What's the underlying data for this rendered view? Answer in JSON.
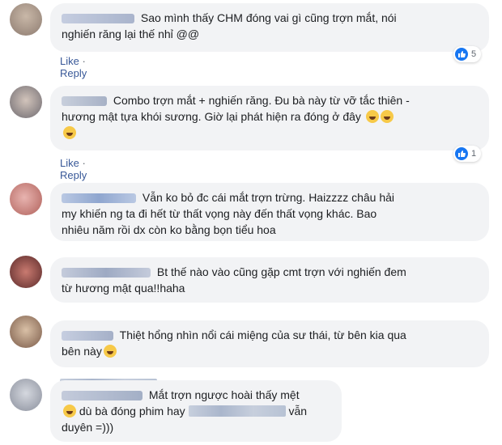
{
  "colors": {
    "link": "#385898",
    "bubble": "#f2f3f5",
    "like_blue": "#1877f2"
  },
  "comments": [
    {
      "text_line1": "Sao mình thấy CHM đóng vai gì cũng trợn mắt, nói",
      "text_line2": "nghiến răng lại thế nhỉ @@",
      "like": "Like",
      "reply": "Reply",
      "dot": "·",
      "reactions": "5"
    },
    {
      "text_line1": "Combo trợn mắt + nghiến răng. Đu bà này từ vỡ tắc thiên -",
      "text_line2": "hương mật tựa khói sương. Giờ lại phát hiện ra đóng ở đây",
      "like": "Like",
      "reply": "Reply",
      "dot": "·",
      "reactions": "1"
    },
    {
      "text_line1": "Vẫn ko bỏ đc cái mắt trợn trừng. Haizzzz châu hải",
      "text_line2": "my khiến ng ta đi hết từ thất vọng này đến thất vọng khác. Bao",
      "text_line3": "nhiêu năm rồi dx còn ko bằng bọn tiểu hoa"
    },
    {
      "text_line1": "Bt thế nào vào cũng gặp cmt trợn với nghiến đem",
      "text_line2": "từ hương mật qua!!haha"
    },
    {
      "text_line1": "Thiệt hổng nhìn nổi cái miệng của sư thái, từ bên kia qua",
      "text_line2": "bên này"
    },
    {
      "text_line1": "Mắt trợn ngược hoài thấy mệt",
      "text_line2": "dù bà đóng phim hay",
      "text_line2b": "vẫn",
      "text_line3": "duyên =)))"
    }
  ]
}
